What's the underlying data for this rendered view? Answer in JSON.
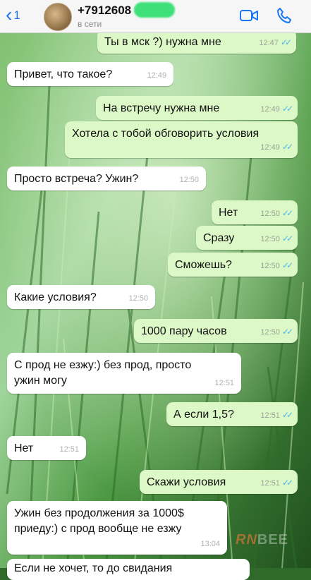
{
  "header": {
    "back_count": "1",
    "phone": "+7912608",
    "status": "в сети"
  },
  "messages": [
    {
      "dir": "out",
      "text": "Ты в мск ?) нужна мне",
      "time": "12:47",
      "ticks": "✓✓"
    },
    {
      "dir": "in",
      "text": "Привет, что такое?",
      "time": "12:49"
    },
    {
      "dir": "out",
      "text": "На встречу нужна мне",
      "time": "12:49",
      "ticks": "✓✓"
    },
    {
      "dir": "out",
      "text": "Хотела с тобой обговорить условия",
      "time": "12:49",
      "ticks": "✓✓"
    },
    {
      "dir": "in",
      "text": "Просто встреча? Ужин?",
      "time": "12:50"
    },
    {
      "dir": "out",
      "text": "Нет",
      "time": "12:50",
      "ticks": "✓✓"
    },
    {
      "dir": "out",
      "text": "Сразу",
      "time": "12:50",
      "ticks": "✓✓"
    },
    {
      "dir": "out",
      "text": "Сможешь?",
      "time": "12:50",
      "ticks": "✓✓"
    },
    {
      "dir": "in",
      "text": "Какие условия?",
      "time": "12:50"
    },
    {
      "dir": "out",
      "text": "1000 пару часов",
      "time": "12:50",
      "ticks": "✓✓"
    },
    {
      "dir": "in",
      "text_line1": "С прод не езжу:) без прод, просто",
      "text_line2": "ужин могу",
      "time": "12:51"
    },
    {
      "dir": "out",
      "text": "А если 1,5?",
      "time": "12:51",
      "ticks": "✓✓"
    },
    {
      "dir": "in",
      "text": "Нет",
      "time": "12:51"
    },
    {
      "dir": "out",
      "text": "Скажи условия",
      "time": "12:51",
      "ticks": "✓✓"
    },
    {
      "dir": "in",
      "text_line1": "Ужин без продолжения за 1000$",
      "text_line2": "приеду:) с прод вообще не езжу",
      "time": "13:04"
    },
    {
      "dir": "in",
      "text": "Если не хочет, то до свидания",
      "time": ""
    }
  ],
  "watermark": {
    "part1": "RN",
    "part2": "BEE"
  }
}
